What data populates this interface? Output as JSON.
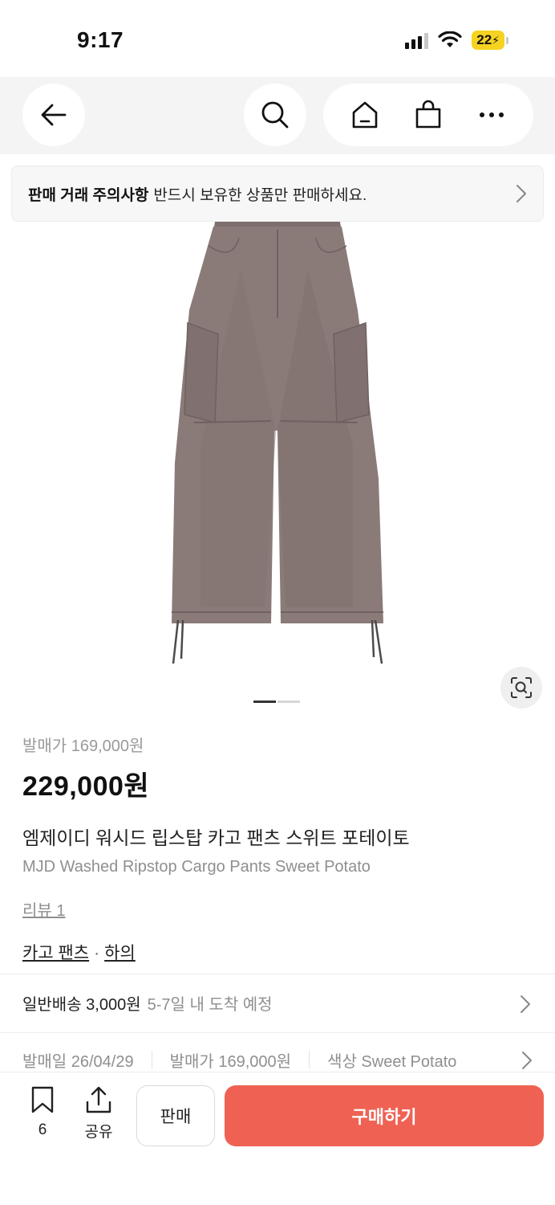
{
  "status_bar": {
    "time": "9:17",
    "battery": "22",
    "battery_color": "#f5d320"
  },
  "nav": {
    "icons": [
      "back-arrow-icon",
      "search-icon",
      "home-icon",
      "shopping-bag-icon",
      "more-icon"
    ]
  },
  "notice": {
    "title": "판매 거래 주의사항",
    "text": "반드시 보유한 상품만 판매하세요."
  },
  "gallery": {
    "active_index": 1,
    "count": 2
  },
  "product": {
    "release_price_label": "발매가 169,000원",
    "price": "229,000원",
    "title_ko": "엠제이디 워시드 립스탑 카고 팬츠 스위트 포테이토",
    "title_en": "MJD Washed Ripstop Cargo Pants Sweet Potato",
    "reviews": "리뷰 1",
    "category": "카고 팬츠",
    "category_separator": "·",
    "parent_category": "하의"
  },
  "shipping": {
    "main": "일반배송 3,000원",
    "sub": "5-7일 내 도착 예정"
  },
  "meta": {
    "release_date": "발매일 26/04/29",
    "release_price": "발매가 169,000원",
    "color": "색상 Sweet Potato"
  },
  "bottom_bar": {
    "bookmark_count": "6",
    "share_label": "공유",
    "sell_label": "판매",
    "buy_label": "구매하기",
    "buy_color": "#ef6253"
  }
}
